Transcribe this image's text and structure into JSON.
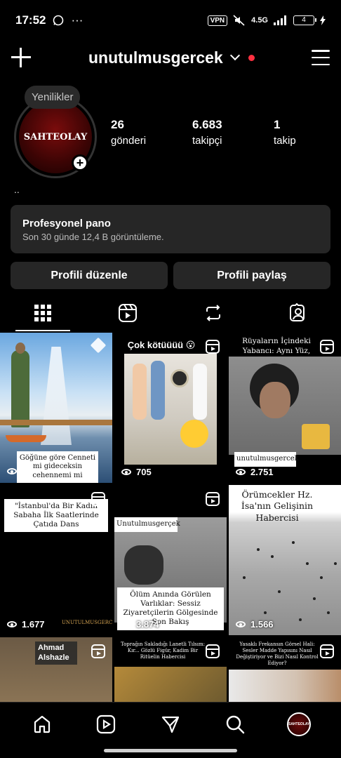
{
  "status_bar": {
    "time": "17:52",
    "extra": "···",
    "vpn": "VPN",
    "network": "4.5G",
    "battery": "4"
  },
  "header": {
    "username": "unutulmusgercek"
  },
  "profile": {
    "note": "Yenilikler",
    "avatar_text": "SAHTEOLAY",
    "bio": "..",
    "stats": [
      {
        "num": "26",
        "label": "gönderi"
      },
      {
        "num": "6.683",
        "label": "takipçi"
      },
      {
        "num": "1",
        "label": "takip"
      }
    ]
  },
  "pro_panel": {
    "title": "Profesyonel pano",
    "subtitle": "Son 30 günde 12,4 B görüntüleme."
  },
  "buttons": {
    "edit": "Profili düzenle",
    "share": "Profili paylaş"
  },
  "tabs": [
    "grid-icon",
    "reels-icon",
    "reposts-icon",
    "tagged-icon"
  ],
  "posts": [
    {
      "views": "",
      "caption": "Göğüne göre Cenneti mi gideceksin cehennemi mi",
      "type": "pinned"
    },
    {
      "views": "705",
      "caption": "Çok kötüüüü 😮",
      "type": "reel"
    },
    {
      "views": "2.751",
      "caption": "Rüyaların İçindeki Yabancı: Aynı Yüz, Farklı Hayatlar",
      "tag": "unutulmusgercek",
      "type": "reel"
    },
    {
      "views": "1.677",
      "caption": "\"İstanbul'da Bir Kadın Sabaha İlk Saatlerinde Çatıda Dans",
      "tag": "UNUTULMUSGERCE",
      "type": "reel"
    },
    {
      "views": "3.874",
      "caption": "Ölüm Anında Görülen Varlıklar: Sessiz Ziyaretçilerin Gölgesinde Son Bakış",
      "tag": "Unutulmusgerçek",
      "type": "reel"
    },
    {
      "views": "1.566",
      "caption": "Örümcekler Hz. İsa'nın Gelişinin Habercisi",
      "type": "reel"
    },
    {
      "views": "",
      "caption": "Ahmad Alshazle",
      "type": "reel"
    },
    {
      "views": "",
      "caption": "Toprağın Sakladığı Lanetli Tılsım: Kır... Gözlü Figür, Kadim Bir Ritüelin Habercisi",
      "type": "reel"
    },
    {
      "views": "",
      "caption": "Yasaklı Frekansın Görsel Hali: Sesler Madde Yapısını Nasıl Değiştiriyor ve Bizi Nasıl Kontrol Ediyor?",
      "type": "reel"
    }
  ],
  "nav": [
    "home-icon",
    "reels-icon",
    "send-icon",
    "search-icon",
    "profile-avatar"
  ]
}
